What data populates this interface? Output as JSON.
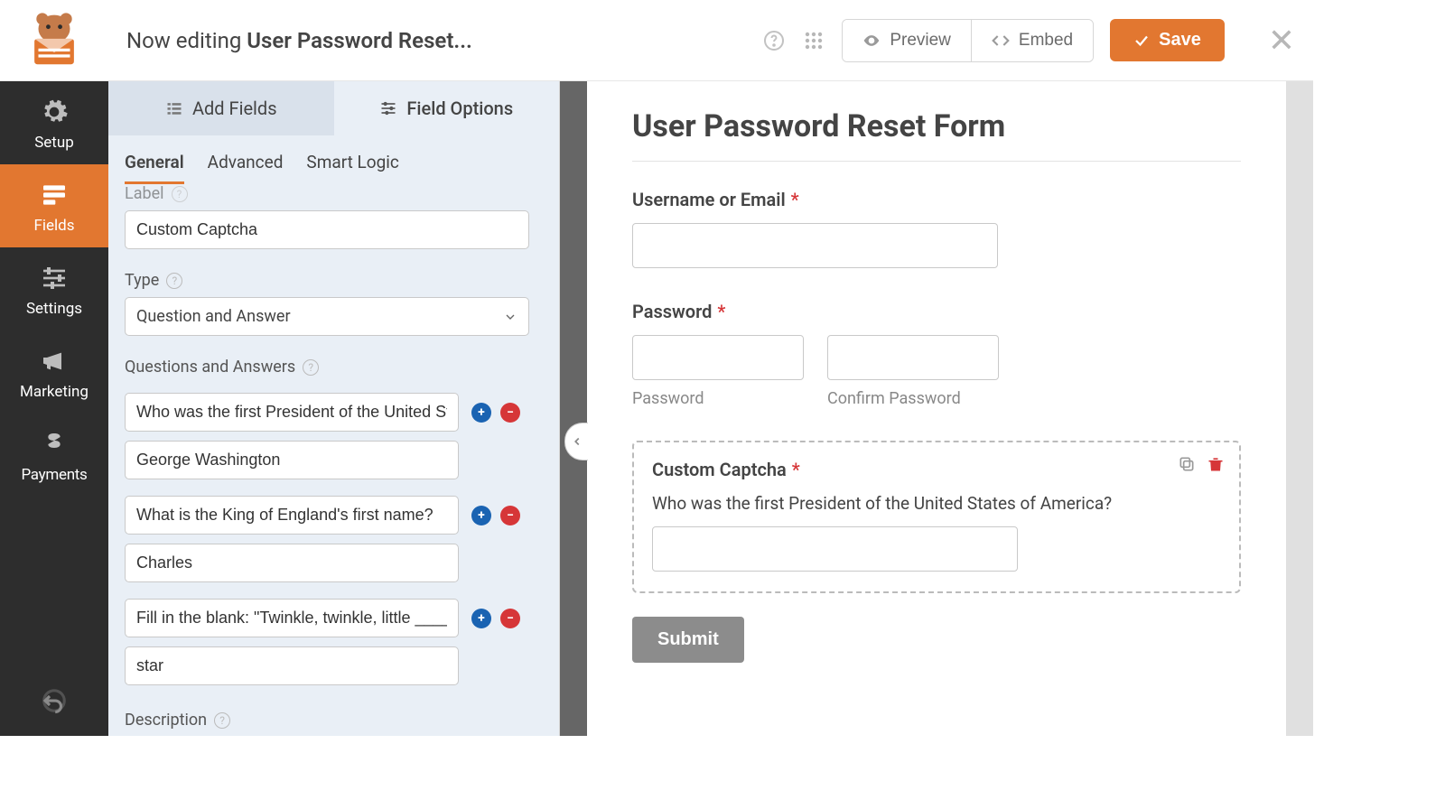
{
  "header": {
    "editing_prefix": "Now editing",
    "form_name": "User Password Reset...",
    "preview_label": "Preview",
    "embed_label": "Embed",
    "save_label": "Save"
  },
  "nav": {
    "setup": "Setup",
    "fields": "Fields",
    "settings": "Settings",
    "marketing": "Marketing",
    "payments": "Payments"
  },
  "panel": {
    "tabs": {
      "add": "Add Fields",
      "options": "Field Options"
    },
    "subtabs": {
      "general": "General",
      "advanced": "Advanced",
      "smart": "Smart Logic"
    },
    "label_heading": "Label",
    "label_value": "Custom Captcha",
    "type_heading": "Type",
    "type_value": "Question and Answer",
    "qa_heading": "Questions and Answers",
    "qa": [
      {
        "q": "Who was the first President of the United States of America?",
        "a": "George Washington"
      },
      {
        "q": "What is the King of England's first name?",
        "a": "Charles"
      },
      {
        "q": "Fill in the blank: \"Twinkle, twinkle, little ____\"",
        "a": "star"
      }
    ],
    "description_heading": "Description"
  },
  "form": {
    "title": "User Password Reset Form",
    "fields": {
      "username": {
        "label": "Username or Email"
      },
      "password": {
        "label": "Password",
        "sub1": "Password",
        "sub2": "Confirm Password"
      },
      "captcha": {
        "label": "Custom Captcha",
        "question": "Who was the first President of the United States of America?"
      }
    },
    "submit_label": "Submit"
  }
}
